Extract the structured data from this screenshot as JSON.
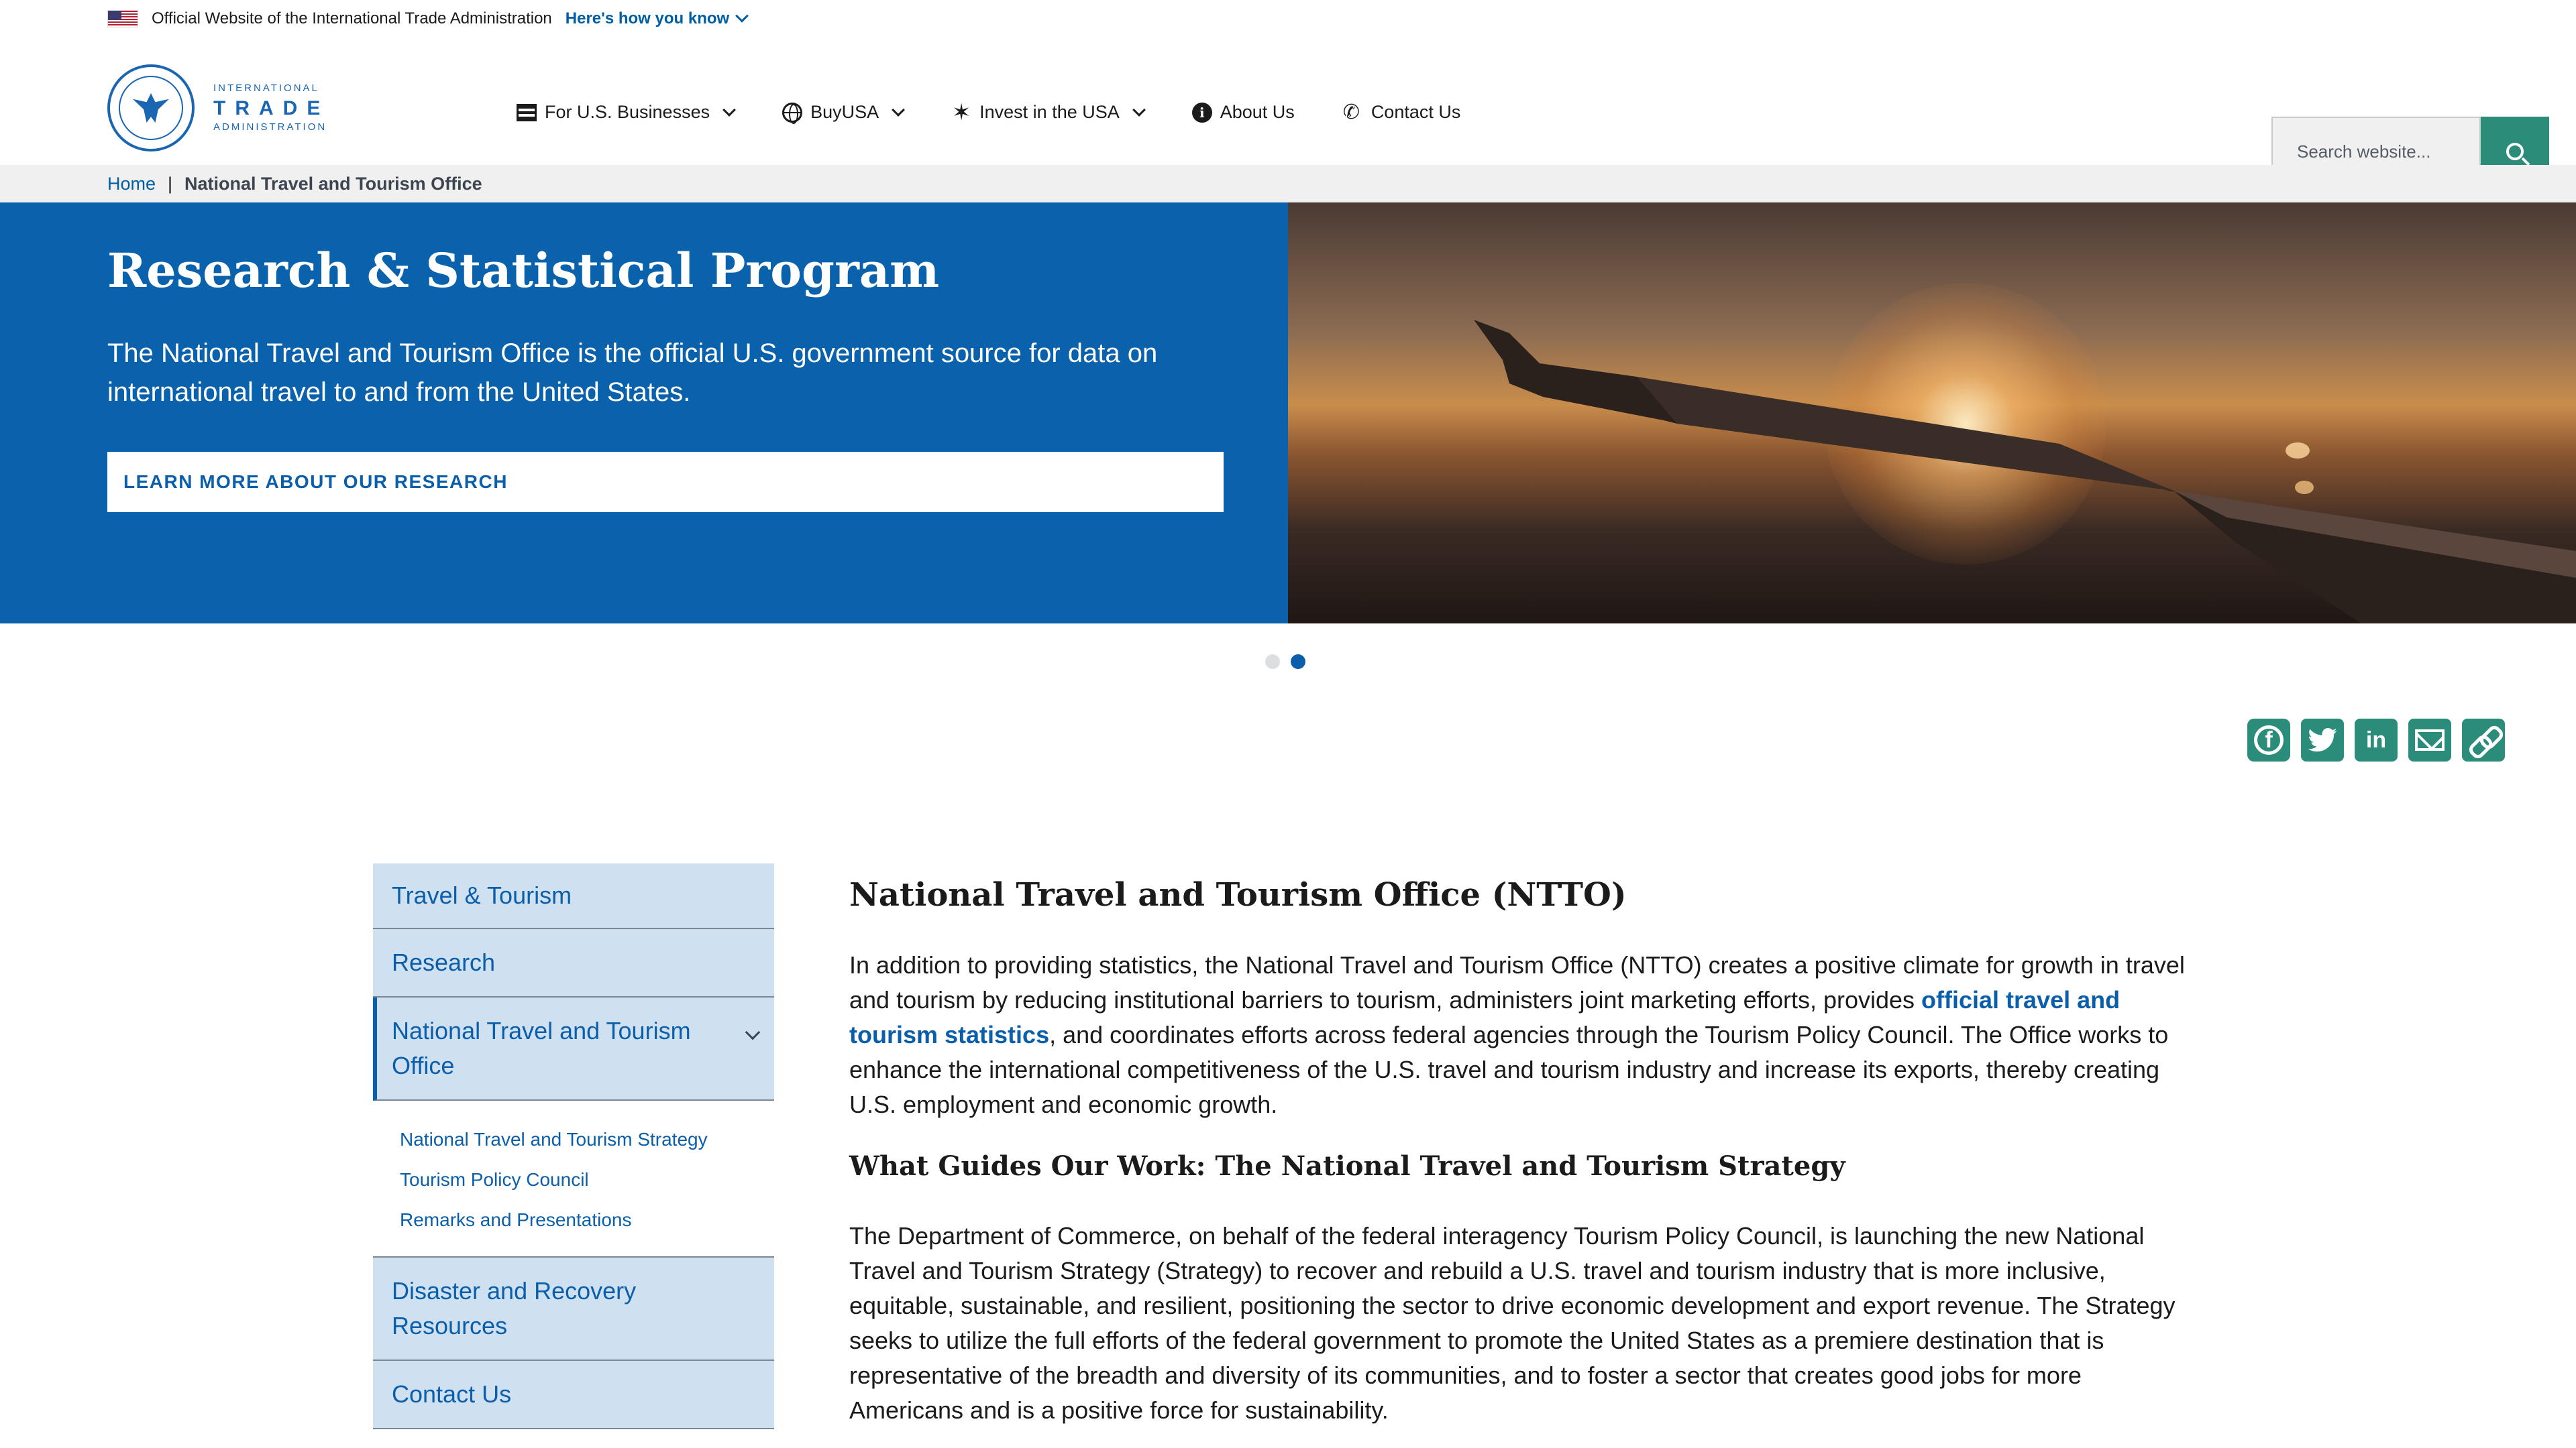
{
  "gov_banner": {
    "text": "Official Website of the International Trade Administration",
    "link": "Here's how you know"
  },
  "logo": {
    "line1": "INTERNATIONAL",
    "line2": "TRADE",
    "line3": "ADMINISTRATION"
  },
  "nav": {
    "items": [
      {
        "label": "For U.S. Businesses",
        "icon": "business-icon",
        "has_dropdown": true
      },
      {
        "label": "BuyUSA",
        "icon": "globe-icon",
        "has_dropdown": true
      },
      {
        "label": "Invest in the USA",
        "icon": "star-icon",
        "has_dropdown": true
      },
      {
        "label": "About Us",
        "icon": "info-icon",
        "has_dropdown": false
      },
      {
        "label": "Contact Us",
        "icon": "phone-icon",
        "has_dropdown": false
      }
    ]
  },
  "search": {
    "placeholder": "Search website..."
  },
  "breadcrumb": {
    "home": "Home",
    "separator": "|",
    "current": "National Travel and Tourism Office"
  },
  "hero": {
    "title": "Research & Statistical Program",
    "body": "The National Travel and Tourism Office is the official U.S. government source for data on international travel to and from the United States.",
    "button": "LEARN MORE ABOUT OUR RESEARCH",
    "slide_count": 2,
    "active_slide": 2,
    "image": "airplane-wing-sunset"
  },
  "share": {
    "items": [
      "facebook-icon",
      "twitter-icon",
      "linkedin-icon",
      "email-icon",
      "copy-link-icon"
    ]
  },
  "sidebar": {
    "items": [
      {
        "label": "Travel & Tourism"
      },
      {
        "label": "Research"
      },
      {
        "label": "National Travel and Tourism Office",
        "expanded": true
      },
      {
        "label": "Disaster and Recovery Resources"
      },
      {
        "label": "Contact Us"
      }
    ],
    "sub_items": [
      {
        "label": "National Travel and Tourism Strategy"
      },
      {
        "label": "Tourism Policy Council"
      },
      {
        "label": "Remarks and Presentations"
      }
    ]
  },
  "main": {
    "title": "National Travel and Tourism Office (NTTO)",
    "p1_before": "In addition to providing statistics, the National Travel and Tourism Office (NTTO) creates a positive climate for growth in travel and tourism by reducing institutional barriers to tourism, administers joint marketing efforts, provides ",
    "p1_link": "official travel and tourism statistics",
    "p1_after": ", and coordinates efforts across federal agencies through the Tourism Policy Council. The Office works to enhance the international competitiveness of the U.S. travel and tourism industry and increase its exports, thereby creating U.S. employment and economic growth.",
    "subtitle": "What Guides Our Work: The National Travel and Tourism Strategy",
    "p2": "The Department of Commerce, on behalf of the federal interagency Tourism Policy Council, is launching the new National Travel and Tourism Strategy (Strategy) to recover and rebuild a U.S. travel and tourism industry that is more inclusive, equitable, sustainable, and resilient, positioning the sector to drive economic development and export revenue. The Strategy seeks to utilize the full efforts of the federal government to promote the United States as a premiere destination that is representative of the breadth and diversity of its communities, and to foster a sector that creates good jobs for more Americans and is a positive force for sustainability."
  },
  "colors": {
    "primary_blue": "#0b62ac",
    "link_blue": "#005ea2",
    "teal": "#2a8c79",
    "sidebar_bg": "#cfe0f0"
  }
}
